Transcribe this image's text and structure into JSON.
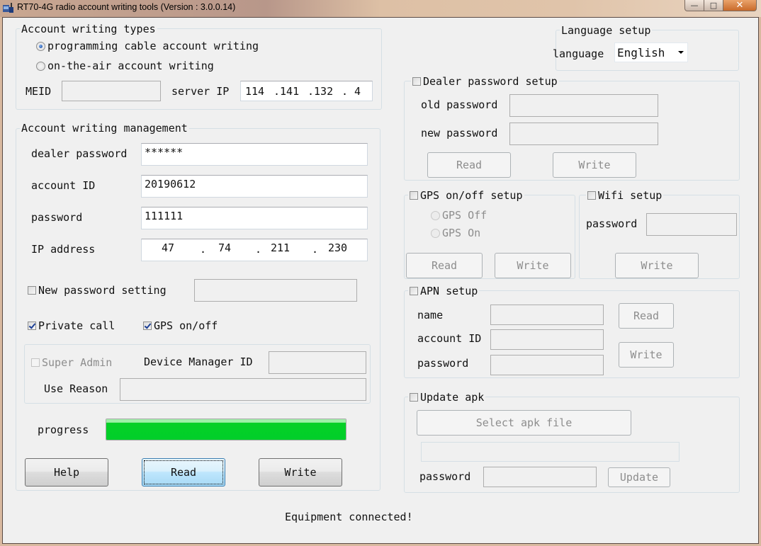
{
  "window": {
    "title": "RT70-4G radio account writing tools (Version : 3.0.0.14)",
    "controls": {
      "minimize": "minimize",
      "maximize": "maximize",
      "close": "close"
    },
    "close_glyph": "✕",
    "minimize_glyph": "—",
    "maximize_glyph": "□"
  },
  "account_writing_types": {
    "title": "Account writing types",
    "options": [
      {
        "label": "programming cable account writing",
        "selected": true
      },
      {
        "label": "on-the-air account writing",
        "selected": false
      }
    ],
    "meid_label": "MEID",
    "meid_value": "",
    "server_ip_label": "server IP",
    "server_ip": [
      "114",
      ".141",
      ".132",
      ". 4"
    ]
  },
  "account_writing_management": {
    "title": "Account writing management",
    "dealer_password_label": "dealer password",
    "dealer_password_value": "******",
    "account_id_label": "account ID",
    "account_id_value": "20190612",
    "password_label": "password",
    "password_value": "111111",
    "ip_address_label": "IP address",
    "ip_address": [
      "47",
      ".",
      "74",
      ".",
      "211",
      ".",
      "230"
    ],
    "new_password_setting_label": "New password setting",
    "new_password_setting_checked": false,
    "new_password_value": "",
    "private_call_label": "Private call",
    "private_call_checked": true,
    "gps_onoff_label": "GPS on/off",
    "gps_onoff_checked": true,
    "super_admin_label": "Super Admin",
    "super_admin_checked": false,
    "device_manager_id_label": "Device Manager ID",
    "device_manager_id_value": "",
    "use_reason_label": "Use Reason",
    "use_reason_value": "",
    "progress_label": "progress",
    "progress_percent": 100,
    "buttons": {
      "help": "Help",
      "read": "Read",
      "write": "Write"
    }
  },
  "language_setup": {
    "title": "Language setup",
    "language_label": "language",
    "selected": "English"
  },
  "dealer_password_setup": {
    "title": "Dealer password setup",
    "checked": false,
    "old_password_label": "old password",
    "old_password_value": "",
    "new_password_label": "new password",
    "new_password_value": "",
    "read_label": "Read",
    "write_label": "Write"
  },
  "gps_onoff_setup": {
    "title": "GPS on/off setup",
    "checked": false,
    "options": [
      {
        "label": "GPS Off",
        "selected": false
      },
      {
        "label": "GPS On",
        "selected": false
      }
    ],
    "read_label": "Read",
    "write_label": "Write"
  },
  "wifi_setup": {
    "title": "Wifi setup",
    "checked": false,
    "password_label": "password",
    "password_value": "",
    "write_label": "Write"
  },
  "apn_setup": {
    "title": "APN setup",
    "checked": false,
    "name_label": "name",
    "account_id_label": "account ID",
    "password_label": "password",
    "read_label": "Read",
    "write_label": "Write"
  },
  "update_apk": {
    "title": "Update apk",
    "checked": false,
    "select_file_label": "Select apk file",
    "file_path_value": "",
    "password_label": "password",
    "password_value": "",
    "update_label": "Update"
  },
  "status": {
    "message": "Equipment connected!"
  },
  "colors": {
    "progress_fill": "#00cf2a",
    "focused_button": "#bee6fd",
    "close_button": "#c96a2a"
  }
}
